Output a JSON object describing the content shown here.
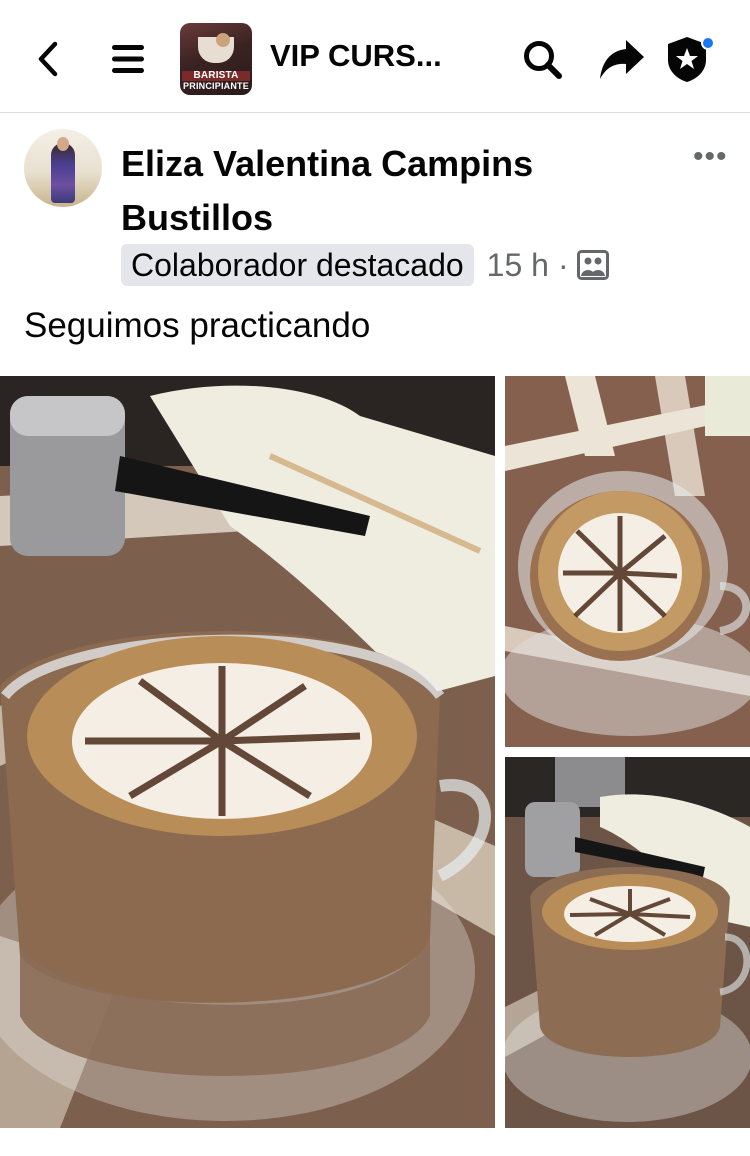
{
  "header": {
    "title": "VIP CURS...",
    "thumbnail_caption_1": "BARISTA",
    "thumbnail_caption_2": "PRINCIPIANTE",
    "icons": [
      "back-icon",
      "menu-icon",
      "search-icon",
      "share-icon",
      "admin-shield-icon"
    ],
    "notification_dot_color": "#1877f2"
  },
  "post": {
    "author": "Eliza Valentina Campins Bustillos",
    "badge": "Colaborador destacado",
    "time": "15 h",
    "separator": "·",
    "audience_icon": "group-audience-icon",
    "text": "Seguimos practicando",
    "more_icon": "more-icon",
    "more_label": "•••"
  },
  "photos": [
    {
      "name": "main-photo",
      "description_icon": "latte-art-photo"
    },
    {
      "name": "top-right-photo",
      "description_icon": "latte-art-photo"
    },
    {
      "name": "bottom-right-photo",
      "description_icon": "latte-art-photo"
    }
  ]
}
